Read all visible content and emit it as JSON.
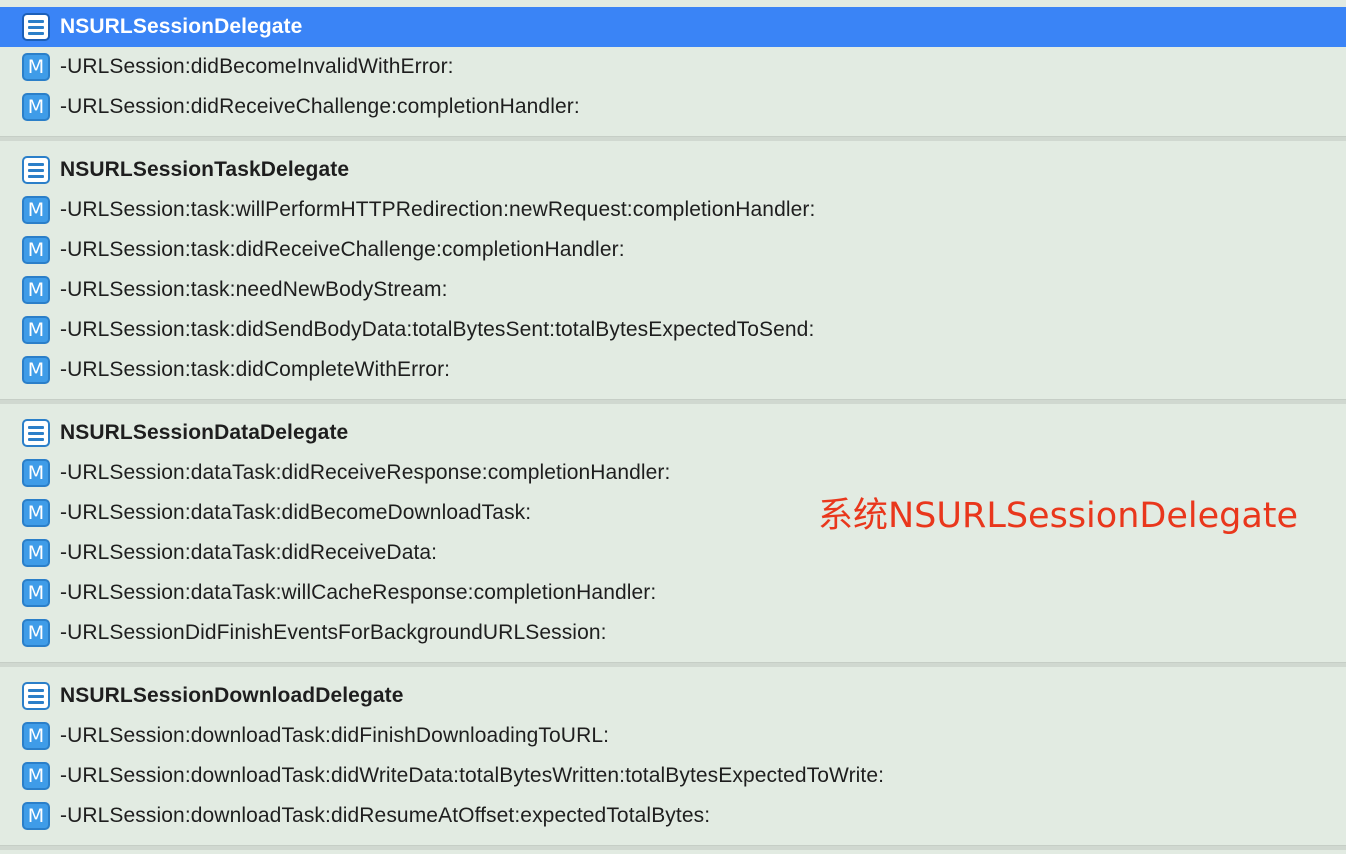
{
  "sections": [
    {
      "title": "NSURLSessionDelegate",
      "selected": true,
      "methods": [
        "-URLSession:didBecomeInvalidWithError:",
        "-URLSession:didReceiveChallenge:completionHandler:"
      ]
    },
    {
      "title": "NSURLSessionTaskDelegate",
      "selected": false,
      "methods": [
        "-URLSession:task:willPerformHTTPRedirection:newRequest:completionHandler:",
        "-URLSession:task:didReceiveChallenge:completionHandler:",
        "-URLSession:task:needNewBodyStream:",
        "-URLSession:task:didSendBodyData:totalBytesSent:totalBytesExpectedToSend:",
        "-URLSession:task:didCompleteWithError:"
      ]
    },
    {
      "title": "NSURLSessionDataDelegate",
      "selected": false,
      "methods": [
        "-URLSession:dataTask:didReceiveResponse:completionHandler:",
        "-URLSession:dataTask:didBecomeDownloadTask:",
        "-URLSession:dataTask:didReceiveData:",
        "-URLSession:dataTask:willCacheResponse:completionHandler:",
        "-URLSessionDidFinishEventsForBackgroundURLSession:"
      ]
    },
    {
      "title": "NSURLSessionDownloadDelegate",
      "selected": false,
      "methods": [
        "-URLSession:downloadTask:didFinishDownloadingToURL:",
        "-URLSession:downloadTask:didWriteData:totalBytesWritten:totalBytesExpectedToWrite:",
        "-URLSession:downloadTask:didResumeAtOffset:expectedTotalBytes:"
      ]
    }
  ],
  "icons": {
    "protocol": "protocol-list-icon",
    "method": "method-icon",
    "method_glyph": "M"
  },
  "annotation": {
    "text": "系统NSURLSessionDelegate",
    "color": "#e9371c"
  },
  "colors": {
    "selection": "#3a84f6",
    "background": "#e2ebe2",
    "icon_blue": "#3f9ce8"
  }
}
